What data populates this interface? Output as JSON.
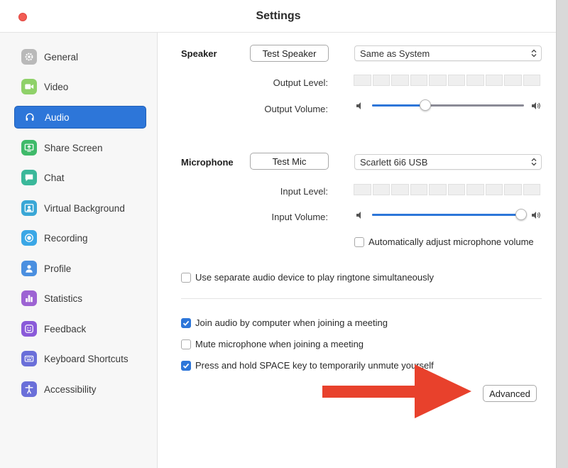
{
  "window": {
    "title": "Settings"
  },
  "sidebar": {
    "items": [
      {
        "label": "General",
        "icon": "gear-icon",
        "color": "#b9b9b9"
      },
      {
        "label": "Video",
        "icon": "video-camera-icon",
        "color": "#8fd169"
      },
      {
        "label": "Audio",
        "icon": "headphones-icon",
        "color": "#2d76d9",
        "active": true
      },
      {
        "label": "Share Screen",
        "icon": "share-screen-icon",
        "color": "#3fba6a"
      },
      {
        "label": "Chat",
        "icon": "chat-bubble-icon",
        "color": "#3ab89a"
      },
      {
        "label": "Virtual Background",
        "icon": "person-portrait-icon",
        "color": "#3aa7d6"
      },
      {
        "label": "Recording",
        "icon": "record-icon",
        "color": "#3aa7e6"
      },
      {
        "label": "Profile",
        "icon": "profile-icon",
        "color": "#4a8fe0"
      },
      {
        "label": "Statistics",
        "icon": "bar-chart-icon",
        "color": "#9d63d3"
      },
      {
        "label": "Feedback",
        "icon": "smiley-icon",
        "color": "#8a5ad9"
      },
      {
        "label": "Keyboard Shortcuts",
        "icon": "keyboard-icon",
        "color": "#6a6fd9"
      },
      {
        "label": "Accessibility",
        "icon": "accessibility-icon",
        "color": "#6a6fd9"
      }
    ]
  },
  "speaker": {
    "label": "Speaker",
    "test_button": "Test Speaker",
    "device": "Same as System",
    "output_level_label": "Output Level:",
    "output_volume_label": "Output Volume:",
    "output_volume": 0.35
  },
  "microphone": {
    "label": "Microphone",
    "test_button": "Test Mic",
    "device": "Scarlett 6i6 USB",
    "input_level_label": "Input Level:",
    "input_volume_label": "Input Volume:",
    "input_volume": 0.98,
    "auto_adjust_label": "Automatically adjust microphone volume",
    "auto_adjust": false
  },
  "options": {
    "separate_device": {
      "label": "Use separate audio device to play ringtone simultaneously",
      "checked": false
    },
    "join_audio": {
      "label": "Join audio by computer when joining a meeting",
      "checked": true
    },
    "mute_mic": {
      "label": "Mute microphone when joining a meeting",
      "checked": false
    },
    "space_unmute": {
      "label": "Press and hold SPACE key to temporarily unmute yourself",
      "checked": true
    }
  },
  "advanced_button": "Advanced",
  "colors": {
    "accent": "#2d76d9",
    "annotation_arrow": "#e8412c"
  }
}
